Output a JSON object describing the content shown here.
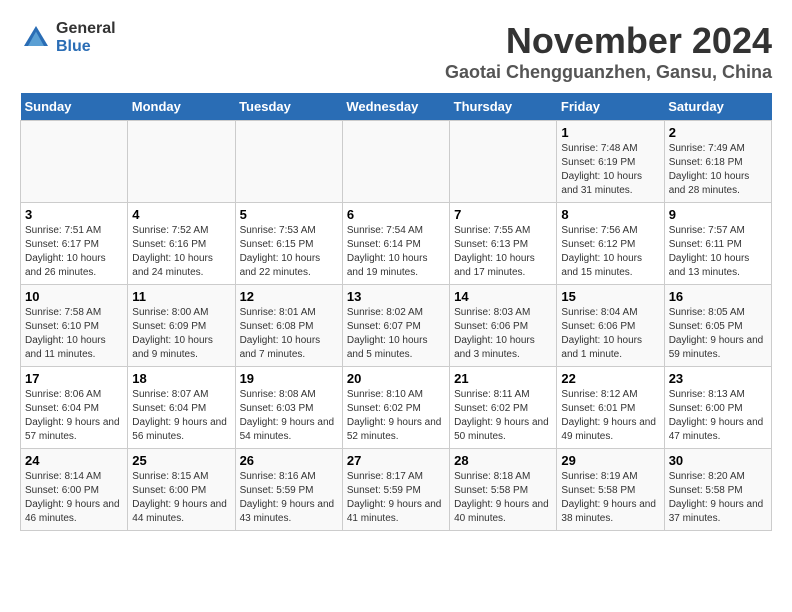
{
  "logo": {
    "general": "General",
    "blue": "Blue"
  },
  "header": {
    "month": "November 2024",
    "location": "Gaotai Chengguanzhen, Gansu, China"
  },
  "weekdays": [
    "Sunday",
    "Monday",
    "Tuesday",
    "Wednesday",
    "Thursday",
    "Friday",
    "Saturday"
  ],
  "weeks": [
    [
      {
        "day": "",
        "info": ""
      },
      {
        "day": "",
        "info": ""
      },
      {
        "day": "",
        "info": ""
      },
      {
        "day": "",
        "info": ""
      },
      {
        "day": "",
        "info": ""
      },
      {
        "day": "1",
        "info": "Sunrise: 7:48 AM\nSunset: 6:19 PM\nDaylight: 10 hours and 31 minutes."
      },
      {
        "day": "2",
        "info": "Sunrise: 7:49 AM\nSunset: 6:18 PM\nDaylight: 10 hours and 28 minutes."
      }
    ],
    [
      {
        "day": "3",
        "info": "Sunrise: 7:51 AM\nSunset: 6:17 PM\nDaylight: 10 hours and 26 minutes."
      },
      {
        "day": "4",
        "info": "Sunrise: 7:52 AM\nSunset: 6:16 PM\nDaylight: 10 hours and 24 minutes."
      },
      {
        "day": "5",
        "info": "Sunrise: 7:53 AM\nSunset: 6:15 PM\nDaylight: 10 hours and 22 minutes."
      },
      {
        "day": "6",
        "info": "Sunrise: 7:54 AM\nSunset: 6:14 PM\nDaylight: 10 hours and 19 minutes."
      },
      {
        "day": "7",
        "info": "Sunrise: 7:55 AM\nSunset: 6:13 PM\nDaylight: 10 hours and 17 minutes."
      },
      {
        "day": "8",
        "info": "Sunrise: 7:56 AM\nSunset: 6:12 PM\nDaylight: 10 hours and 15 minutes."
      },
      {
        "day": "9",
        "info": "Sunrise: 7:57 AM\nSunset: 6:11 PM\nDaylight: 10 hours and 13 minutes."
      }
    ],
    [
      {
        "day": "10",
        "info": "Sunrise: 7:58 AM\nSunset: 6:10 PM\nDaylight: 10 hours and 11 minutes."
      },
      {
        "day": "11",
        "info": "Sunrise: 8:00 AM\nSunset: 6:09 PM\nDaylight: 10 hours and 9 minutes."
      },
      {
        "day": "12",
        "info": "Sunrise: 8:01 AM\nSunset: 6:08 PM\nDaylight: 10 hours and 7 minutes."
      },
      {
        "day": "13",
        "info": "Sunrise: 8:02 AM\nSunset: 6:07 PM\nDaylight: 10 hours and 5 minutes."
      },
      {
        "day": "14",
        "info": "Sunrise: 8:03 AM\nSunset: 6:06 PM\nDaylight: 10 hours and 3 minutes."
      },
      {
        "day": "15",
        "info": "Sunrise: 8:04 AM\nSunset: 6:06 PM\nDaylight: 10 hours and 1 minute."
      },
      {
        "day": "16",
        "info": "Sunrise: 8:05 AM\nSunset: 6:05 PM\nDaylight: 9 hours and 59 minutes."
      }
    ],
    [
      {
        "day": "17",
        "info": "Sunrise: 8:06 AM\nSunset: 6:04 PM\nDaylight: 9 hours and 57 minutes."
      },
      {
        "day": "18",
        "info": "Sunrise: 8:07 AM\nSunset: 6:04 PM\nDaylight: 9 hours and 56 minutes."
      },
      {
        "day": "19",
        "info": "Sunrise: 8:08 AM\nSunset: 6:03 PM\nDaylight: 9 hours and 54 minutes."
      },
      {
        "day": "20",
        "info": "Sunrise: 8:10 AM\nSunset: 6:02 PM\nDaylight: 9 hours and 52 minutes."
      },
      {
        "day": "21",
        "info": "Sunrise: 8:11 AM\nSunset: 6:02 PM\nDaylight: 9 hours and 50 minutes."
      },
      {
        "day": "22",
        "info": "Sunrise: 8:12 AM\nSunset: 6:01 PM\nDaylight: 9 hours and 49 minutes."
      },
      {
        "day": "23",
        "info": "Sunrise: 8:13 AM\nSunset: 6:00 PM\nDaylight: 9 hours and 47 minutes."
      }
    ],
    [
      {
        "day": "24",
        "info": "Sunrise: 8:14 AM\nSunset: 6:00 PM\nDaylight: 9 hours and 46 minutes."
      },
      {
        "day": "25",
        "info": "Sunrise: 8:15 AM\nSunset: 6:00 PM\nDaylight: 9 hours and 44 minutes."
      },
      {
        "day": "26",
        "info": "Sunrise: 8:16 AM\nSunset: 5:59 PM\nDaylight: 9 hours and 43 minutes."
      },
      {
        "day": "27",
        "info": "Sunrise: 8:17 AM\nSunset: 5:59 PM\nDaylight: 9 hours and 41 minutes."
      },
      {
        "day": "28",
        "info": "Sunrise: 8:18 AM\nSunset: 5:58 PM\nDaylight: 9 hours and 40 minutes."
      },
      {
        "day": "29",
        "info": "Sunrise: 8:19 AM\nSunset: 5:58 PM\nDaylight: 9 hours and 38 minutes."
      },
      {
        "day": "30",
        "info": "Sunrise: 8:20 AM\nSunset: 5:58 PM\nDaylight: 9 hours and 37 minutes."
      }
    ]
  ]
}
